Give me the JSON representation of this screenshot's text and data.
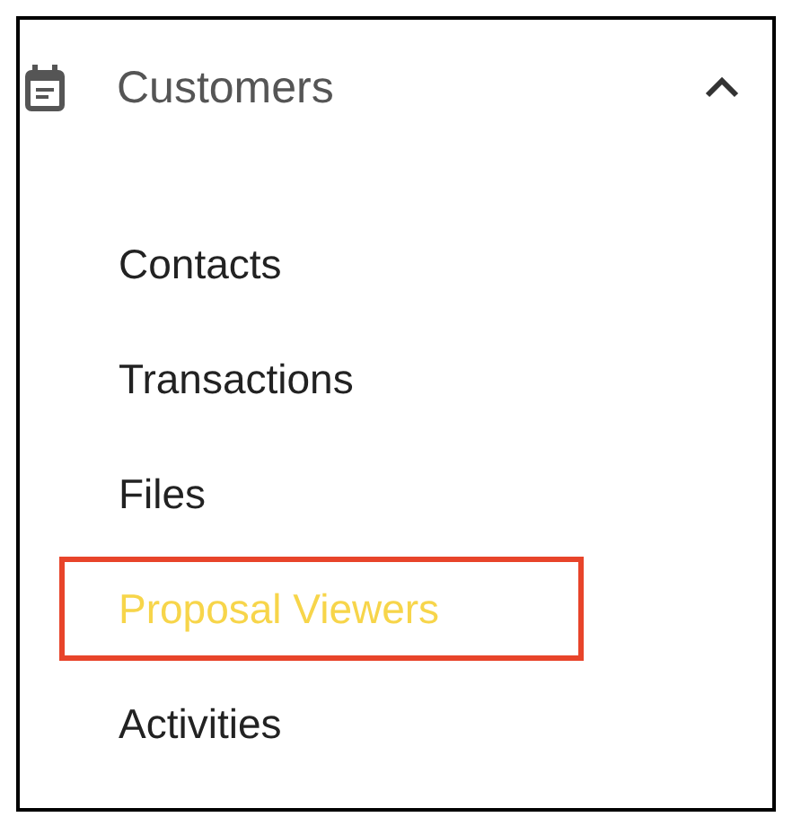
{
  "section": {
    "title": "Customers",
    "expanded": true
  },
  "items": [
    {
      "label": "Contacts",
      "selected": false
    },
    {
      "label": "Transactions",
      "selected": false
    },
    {
      "label": "Files",
      "selected": false
    },
    {
      "label": "Proposal Viewers",
      "selected": true
    },
    {
      "label": "Activities",
      "selected": false
    }
  ]
}
